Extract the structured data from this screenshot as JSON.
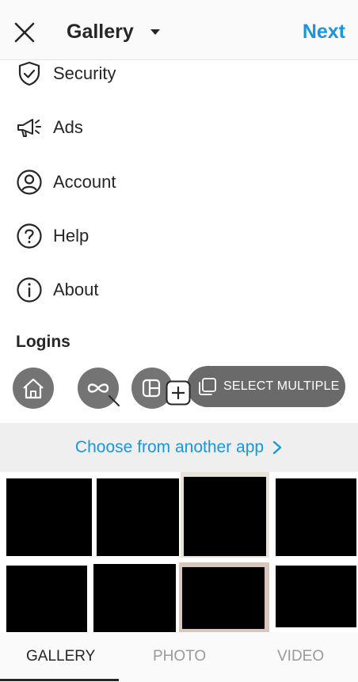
{
  "header": {
    "title": "Gallery",
    "next_label": "Next"
  },
  "menu": {
    "items": [
      {
        "label": "Security",
        "icon": "shield-check-icon"
      },
      {
        "label": "Ads",
        "icon": "megaphone-icon"
      },
      {
        "label": "Account",
        "icon": "user-circle-icon"
      },
      {
        "label": "Help",
        "icon": "question-circle-icon"
      },
      {
        "label": "About",
        "icon": "info-circle-icon"
      }
    ],
    "section_heading": "Logins"
  },
  "toolbar": {
    "buttons": [
      "home-icon",
      "boomerang-icon",
      "layout-icon"
    ],
    "select_multiple_label": "SELECT MULTIPLE"
  },
  "another_app": {
    "label": "Choose from another app"
  },
  "tabs": [
    {
      "label": "GALLERY",
      "active": true
    },
    {
      "label": "PHOTO",
      "active": false
    },
    {
      "label": "VIDEO",
      "active": false
    }
  ],
  "colors": {
    "accent": "#1b95e0",
    "text": "#262626",
    "inactive": "#9a9a9a"
  }
}
